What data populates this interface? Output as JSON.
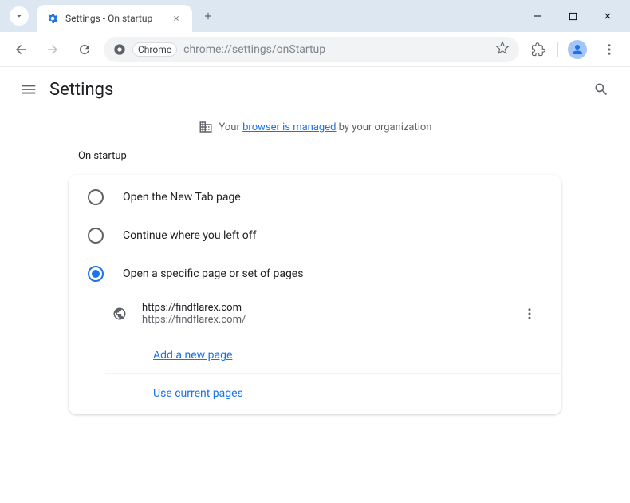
{
  "window": {
    "tab_title": "Settings - On startup"
  },
  "omnibox": {
    "chip": "Chrome",
    "url": "chrome://settings/onStartup"
  },
  "settings_header": {
    "title": "Settings"
  },
  "managed": {
    "prefix": "Your ",
    "link": "browser is managed",
    "suffix": " by your organization"
  },
  "section": {
    "title": "On startup"
  },
  "options": {
    "new_tab": "Open the New Tab page",
    "continue": "Continue where you left off",
    "specific": "Open a specific page or set of pages"
  },
  "pages": [
    {
      "title": "https://findflarex.com",
      "url": "https://findflarex.com/"
    }
  ],
  "actions": {
    "add": "Add a new page",
    "use_current": "Use current pages"
  }
}
